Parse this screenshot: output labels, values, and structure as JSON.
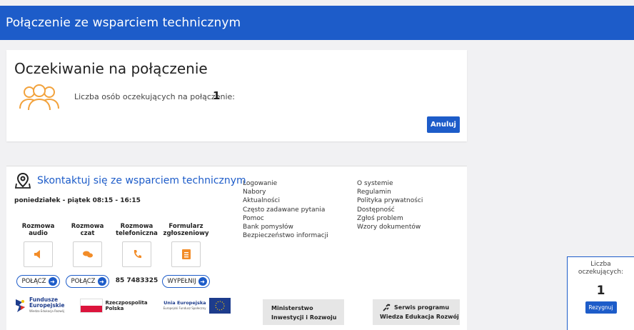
{
  "header": {
    "title": "Połączenie ze wsparciem technicznym"
  },
  "waiting": {
    "heading": "Oczekiwanie na połączenie",
    "count_label": "Liczba osób oczekujących na połączenie:",
    "count_value": "1",
    "cancel_label": "Anuluj"
  },
  "contact": {
    "title": "Skontaktuj się ze wsparciem technicznym",
    "hours": "poniedziałek - piątek 08:15 - 16:15",
    "channels": [
      {
        "label_line1": "Rozmowa",
        "label_line2": "audio",
        "icon": "speaker-icon",
        "action": "POŁĄCZ"
      },
      {
        "label_line1": "Rozmowa",
        "label_line2": "czat",
        "icon": "chat-icon",
        "action": "POŁĄCZ"
      },
      {
        "label_line1": "Rozmowa",
        "label_line2": "telefoniczna",
        "icon": "phone-icon",
        "phone": "85 7483325"
      },
      {
        "label_line1": "Formularz",
        "label_line2": "zgłoszeniowy",
        "icon": "form-icon",
        "action": "WYPEŁNIJ"
      }
    ],
    "accent_color": "#f28c28"
  },
  "links": {
    "col1": [
      "Logowanie",
      "Nabory",
      "Aktualności",
      "Często zadawane pytania",
      "Pomoc",
      "Bank pomysłów",
      "Bezpieczeństwo informacji"
    ],
    "col2": [
      "O systemie",
      "Regulamin",
      "Polityka prywatności",
      "Dostępność",
      "Zgłoś problem",
      "Wzory dokumentów"
    ]
  },
  "logos": {
    "fe_line1": "Fundusze",
    "fe_line2": "Europejskie",
    "fe_line3": "Wiedza Edukacja Rozwój",
    "rp_line1": "Rzeczpospolita",
    "rp_line2": "Polska",
    "ue_line1": "Unia Europejska",
    "ue_line2": "Europejski Fundusz Społeczny",
    "ministry_line1": "Ministerstwo",
    "ministry_line2": "Inwestycji i Rozwoju",
    "service_line1": "Serwis programu",
    "service_line2": "Wiedza Edukacja Rozwój"
  },
  "widget": {
    "label_line1": "Liczba",
    "label_line2": "oczekujących:",
    "count": "1",
    "button": "Rezygnuj"
  },
  "colors": {
    "primary": "#1d5cc9",
    "background": "#f1f1f3",
    "orange": "#f28c28"
  }
}
